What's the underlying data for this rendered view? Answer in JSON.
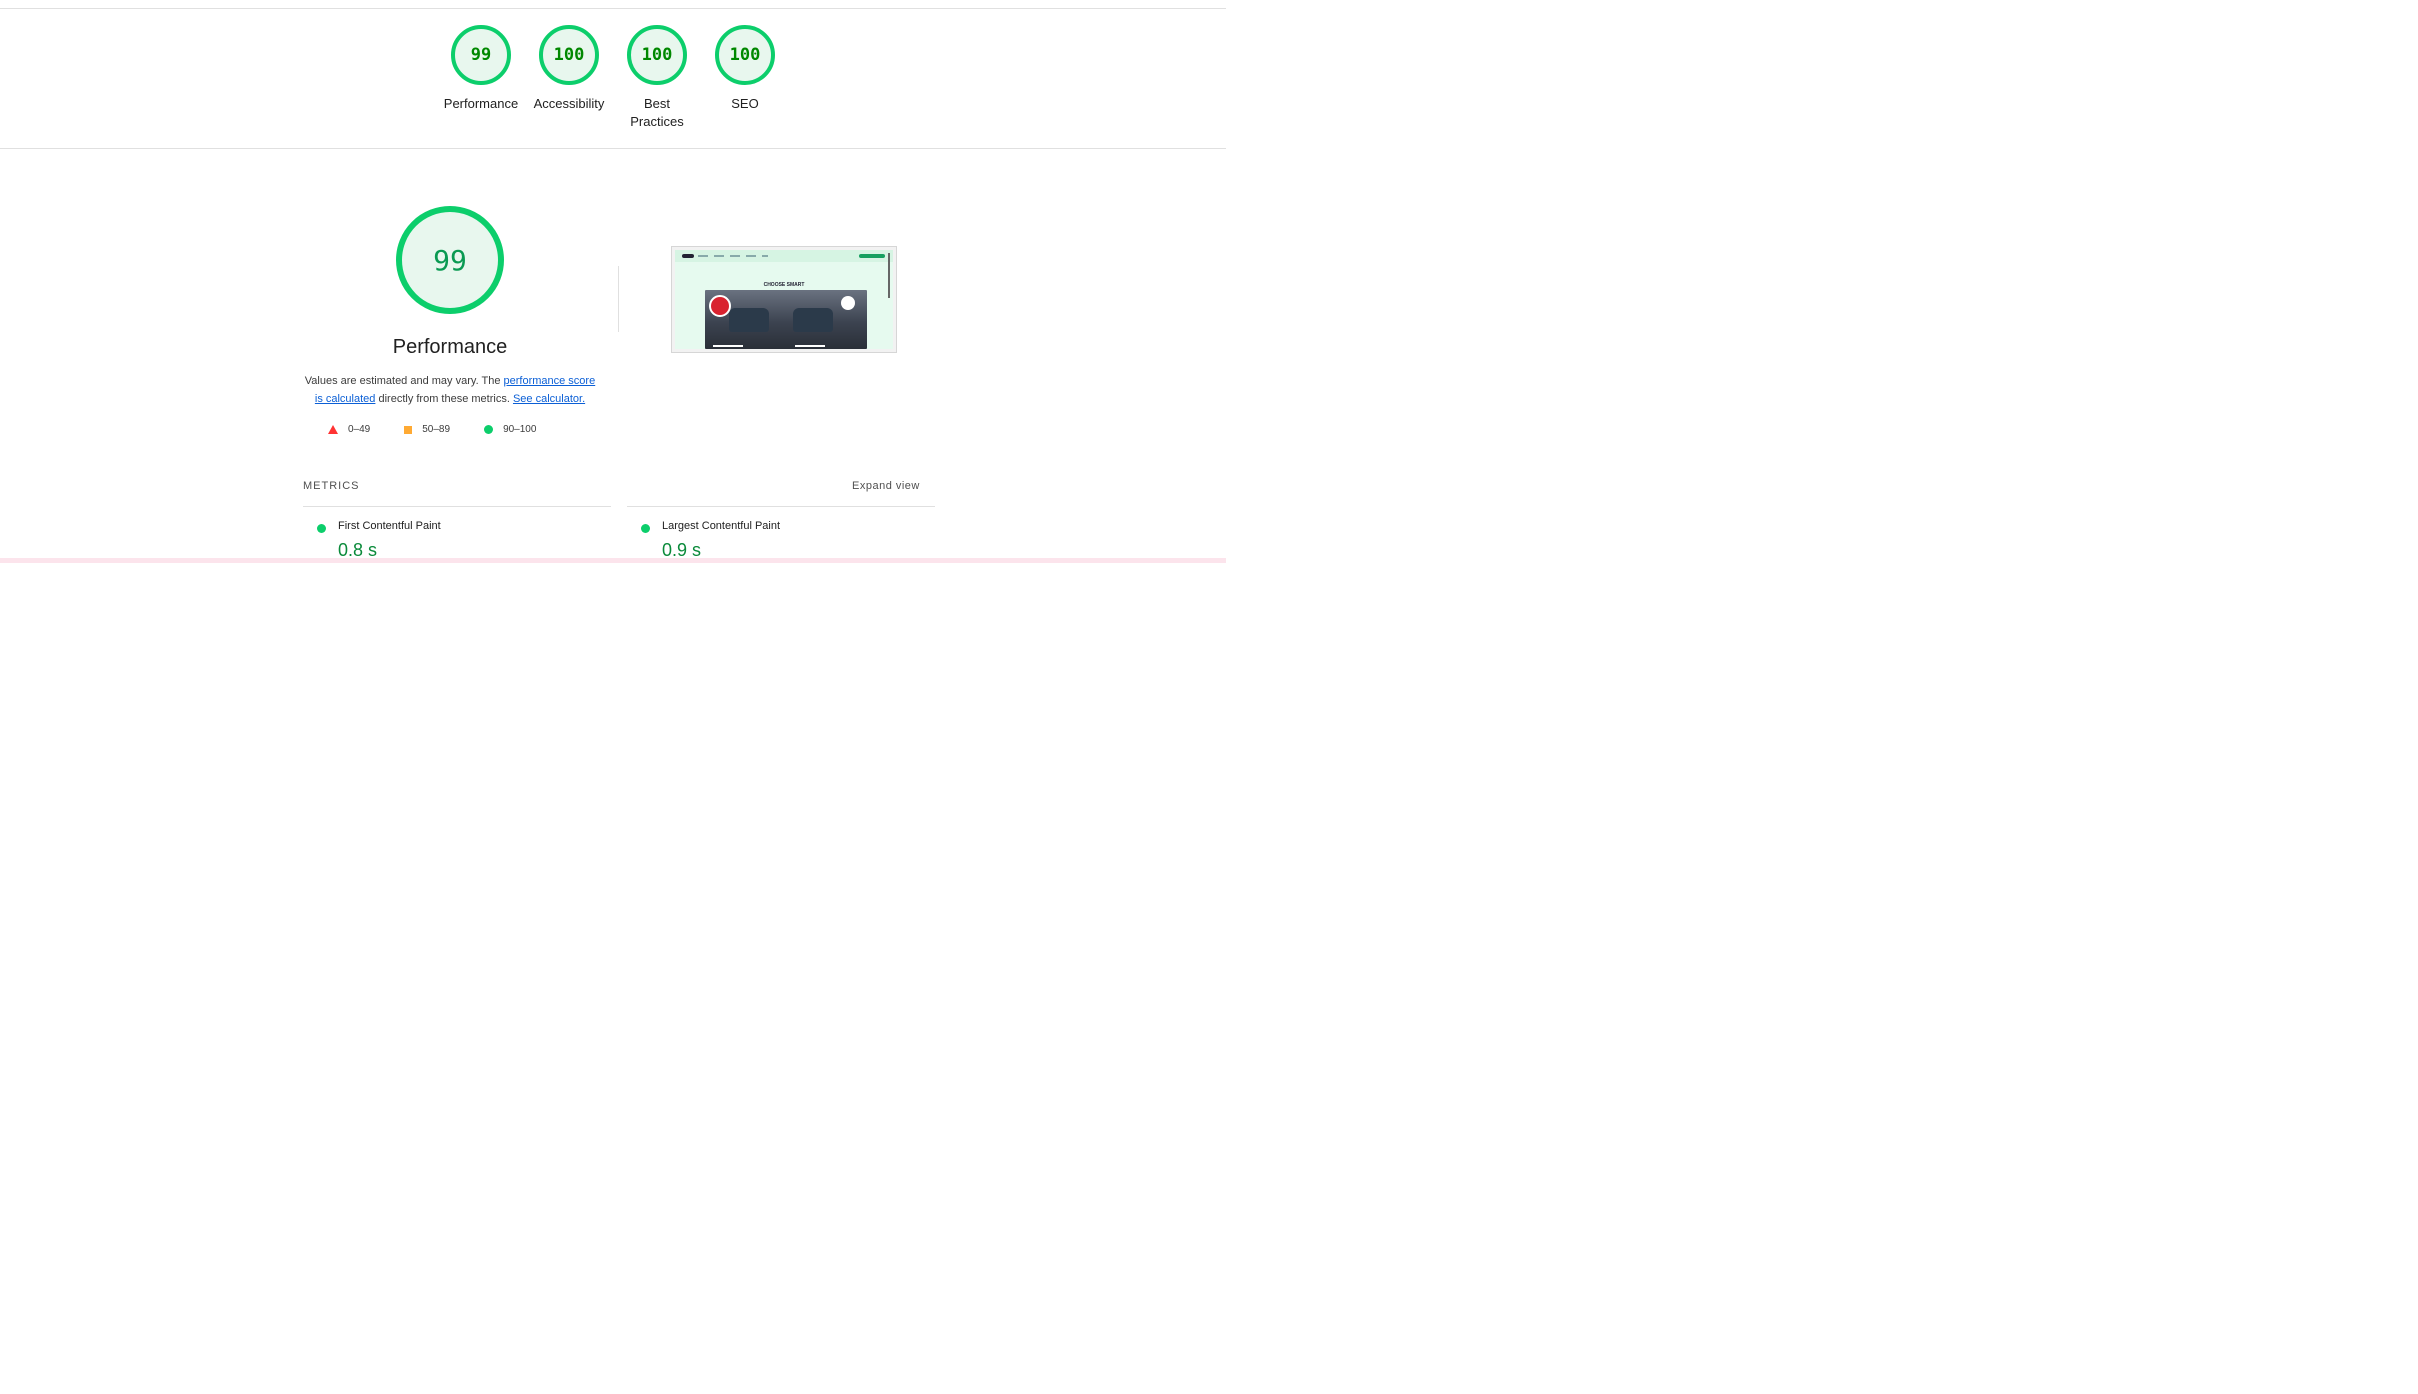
{
  "categories": [
    {
      "score": "99",
      "label": "Performance"
    },
    {
      "score": "100",
      "label": "Accessibility"
    },
    {
      "score": "100",
      "label": "Best\nPractices"
    },
    {
      "score": "100",
      "label": "SEO"
    }
  ],
  "performance": {
    "score": "99",
    "title": "Performance",
    "desc_prefix": "Values are estimated and may vary. The ",
    "desc_link": "performance score is calculated",
    "desc_middle": " directly from these metrics. ",
    "desc_calc_link": "See calculator."
  },
  "legend": {
    "fail": "0–49",
    "average": "50–89",
    "pass": "90–100"
  },
  "thumbnail": {
    "heading": "CHOOSE SMART"
  },
  "metrics": {
    "heading": "METRICS",
    "expand_label": "Expand view",
    "items": [
      {
        "name": "First Contentful Paint",
        "value": "0.8 s"
      },
      {
        "name": "Largest Contentful Paint",
        "value": "0.9 s"
      }
    ]
  },
  "colors": {
    "pass_green": "#0cce6b",
    "fail_red": "#ff3333",
    "average_orange": "#ffaa33",
    "link_blue": "#0b5fd6"
  }
}
